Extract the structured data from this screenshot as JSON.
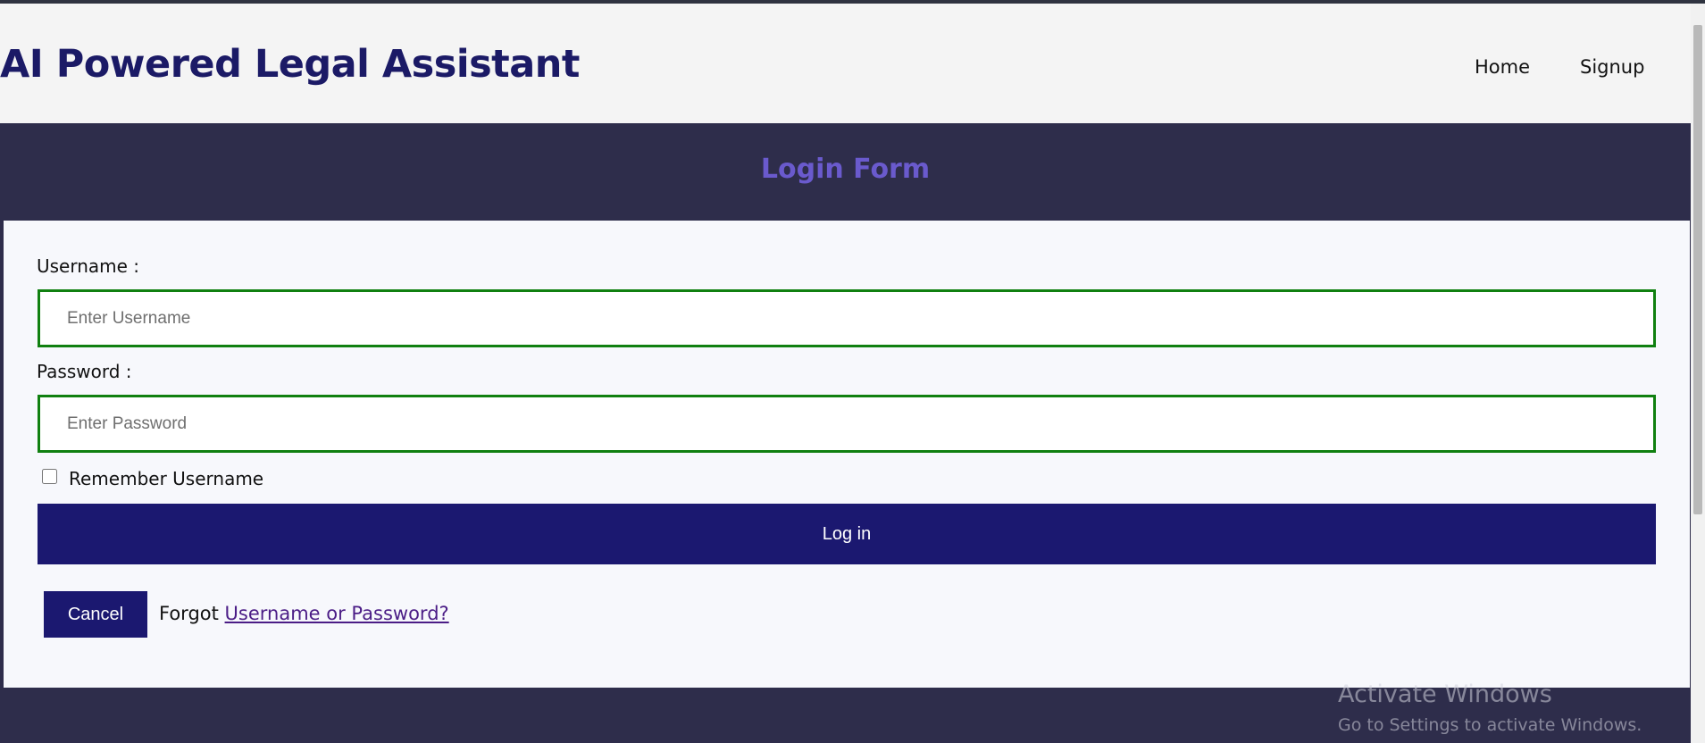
{
  "header": {
    "title": "AI Powered Legal Assistant",
    "nav": {
      "home": "Home",
      "signup": "Signup"
    }
  },
  "banner": {
    "title": "Login Form"
  },
  "form": {
    "username_label": "Username :",
    "username_placeholder": "Enter Username",
    "username_value": "",
    "password_label": "Password :",
    "password_placeholder": "Enter Password",
    "password_value": "",
    "remember_label": "Remember Username",
    "remember_checked": false,
    "login_label": "Log in",
    "cancel_label": "Cancel",
    "forgot_prefix": "Forgot",
    "forgot_link": "Username or Password?"
  },
  "watermark": {
    "title": "Activate Windows",
    "subtitle": "Go to Settings to activate Windows."
  },
  "colors": {
    "header_title": "#1b1a66",
    "banner_bg": "#2e2d4b",
    "banner_title": "#6a5acd",
    "input_border": "#108010",
    "button_bg": "#1b1870",
    "link": "#4b1d86"
  }
}
